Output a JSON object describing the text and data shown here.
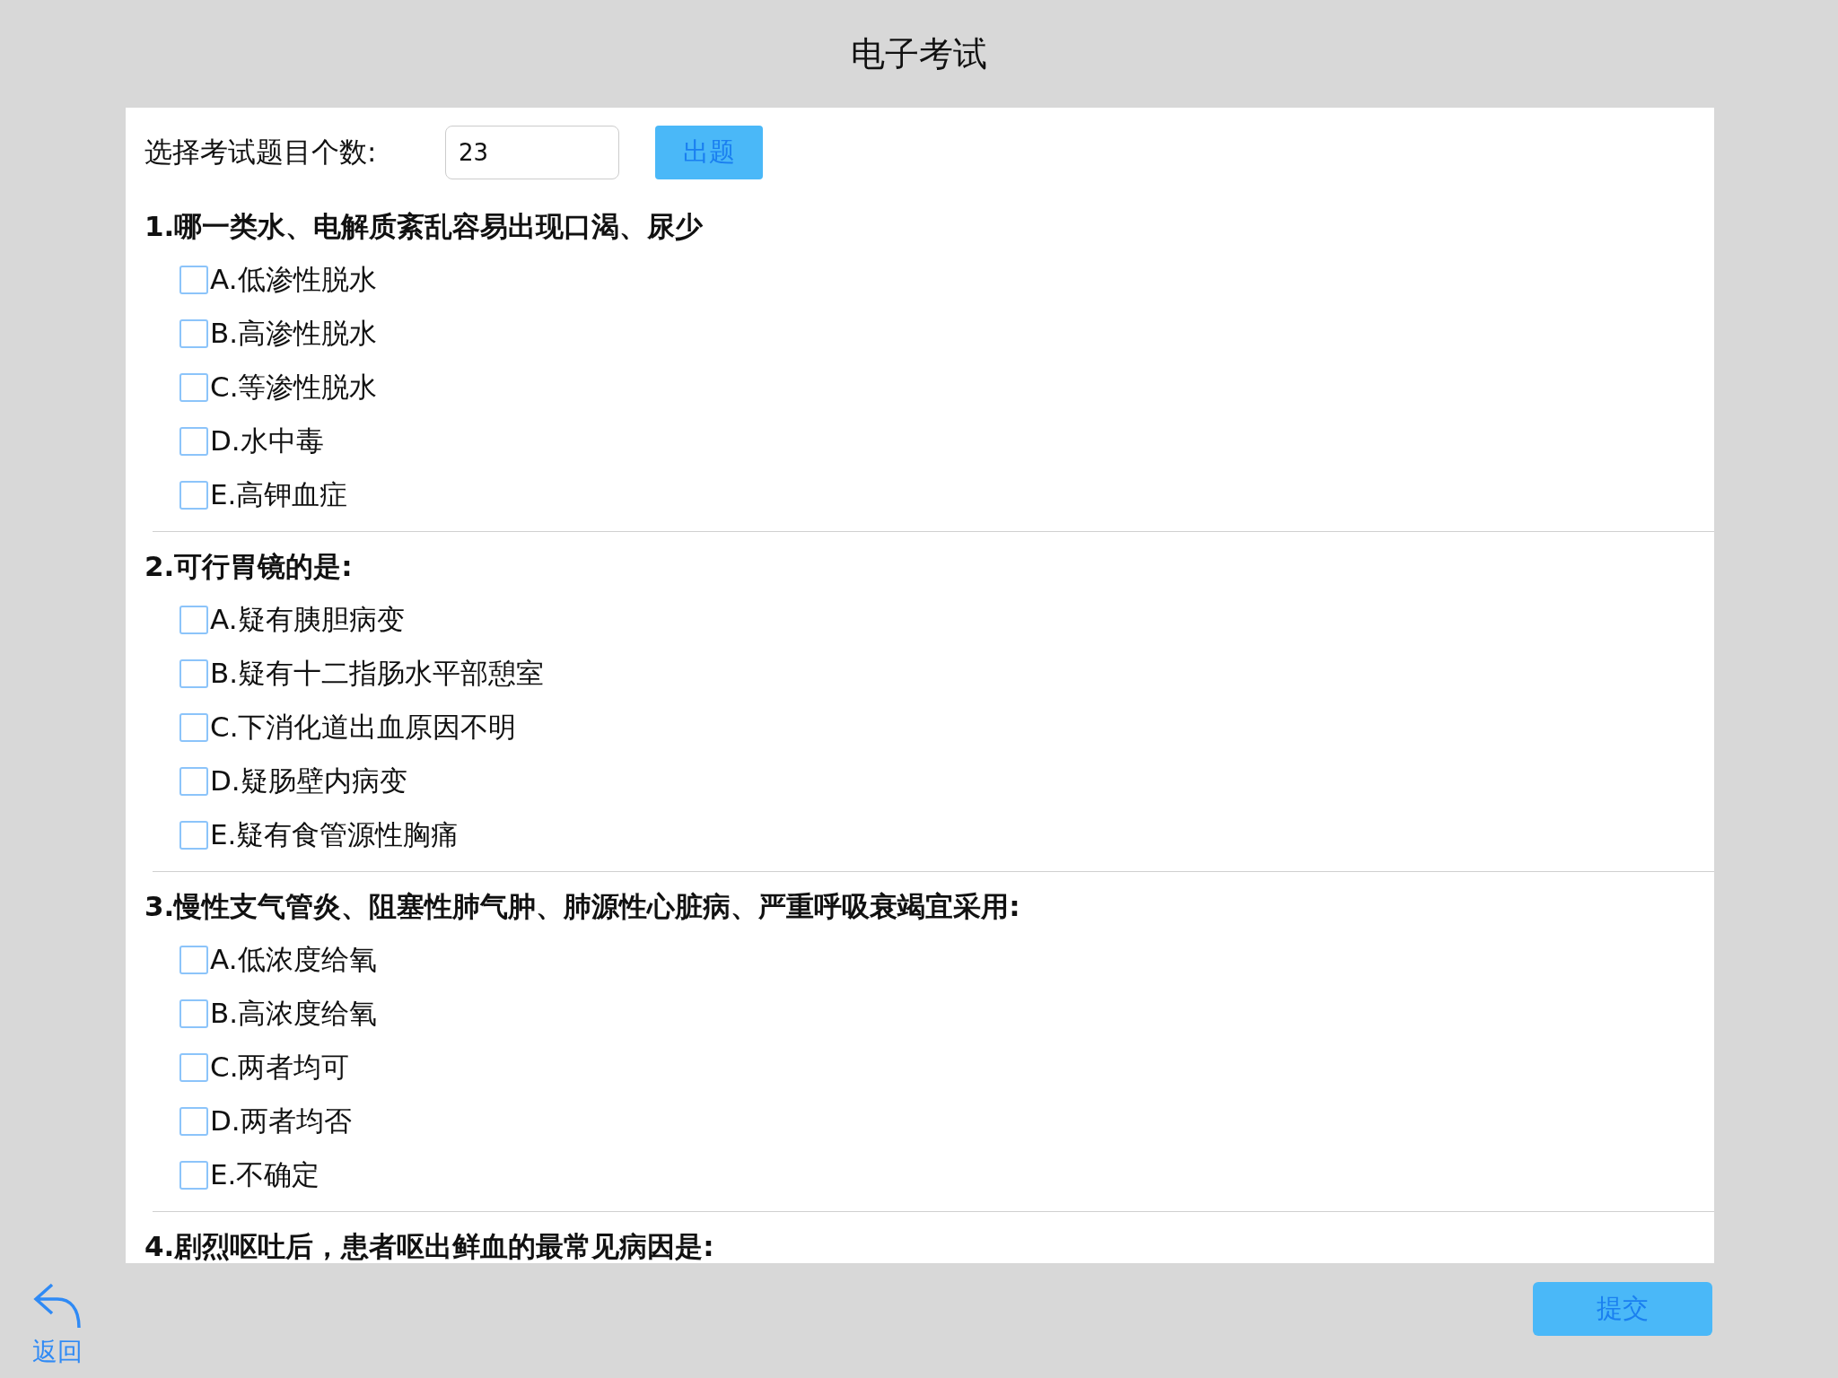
{
  "title": "电子考试",
  "count_field": {
    "label": "选择考试题目个数:",
    "value": "23",
    "button": "出题"
  },
  "questions": [
    {
      "title": "1.哪一类水、电解质紊乱容易出现口渴、尿少",
      "options": [
        {
          "label": "A.低渗性脱水",
          "checked": false
        },
        {
          "label": "B.高渗性脱水",
          "checked": false
        },
        {
          "label": "C.等渗性脱水",
          "checked": false
        },
        {
          "label": "D.水中毒",
          "checked": false
        },
        {
          "label": "E.高钾血症",
          "checked": false
        }
      ]
    },
    {
      "title": "2.可行胃镜的是:",
      "options": [
        {
          "label": "A.疑有胰胆病变",
          "checked": false
        },
        {
          "label": "B.疑有十二指肠水平部憩室",
          "checked": false
        },
        {
          "label": "C.下消化道出血原因不明",
          "checked": false
        },
        {
          "label": "D.疑肠壁内病变",
          "checked": false
        },
        {
          "label": "E.疑有食管源性胸痛",
          "checked": false
        }
      ]
    },
    {
      "title": "3.慢性支气管炎、阻塞性肺气肿、肺源性心脏病、严重呼吸衰竭宜采用:",
      "options": [
        {
          "label": "A.低浓度给氧",
          "checked": false
        },
        {
          "label": "B.高浓度给氧",
          "checked": false
        },
        {
          "label": "C.两者均可",
          "checked": false
        },
        {
          "label": "D.两者均否",
          "checked": false
        },
        {
          "label": "E.不确定",
          "checked": false
        }
      ]
    },
    {
      "title": "4.剧烈呕吐后，患者呕出鲜血的最常见病因是:"
    }
  ],
  "back": "返回",
  "submit": "提交"
}
